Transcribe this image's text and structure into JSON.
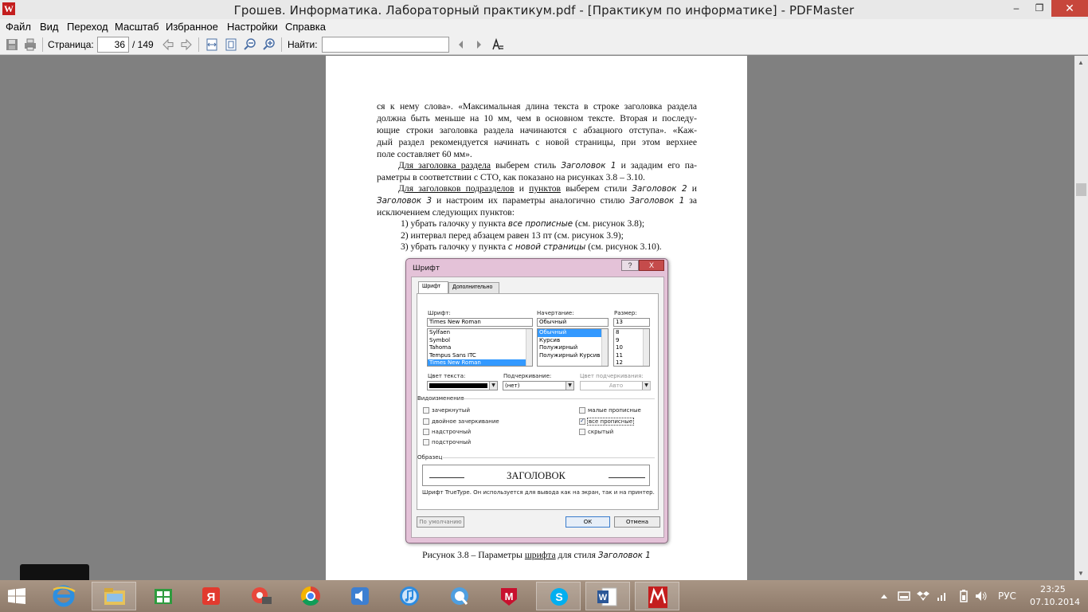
{
  "window": {
    "title": "Грошев. Информатика. Лабораторный практикум.pdf - [Практикум по информатике] - PDFMaster",
    "logo_letter": "W",
    "min_glyph": "–",
    "max_glyph": "❐",
    "close_glyph": "✕"
  },
  "menu": {
    "items": [
      "Файл",
      "Вид",
      "Переход",
      "Масштаб",
      "Избранное",
      "Настройки",
      "Справка"
    ]
  },
  "toolbar": {
    "page_label": "Страница:",
    "page_current": "36",
    "page_total": "/ 149",
    "find_label": "Найти:",
    "find_value": ""
  },
  "pdf": {
    "p1": [
      "ся к нему слова». «Максимальная длина текста в строке заголовка раздела",
      "должна быть меньше на 10 мм, чем в основном тексте. Вторая и последу-",
      "ющие строки заголовка раздела начинаются с абзацного отступа». «Каж-",
      "дый раздел рекомендуется начинать с новой страницы, при этом верхнее"
    ],
    "p1_last": "поле составляет 60 мм».",
    "p2_a": "Для заголовка раздела",
    "p2_b": " выберем стиль ",
    "p2_c": "Заголовок 1",
    "p2_d": " и зададим его па-",
    "p2_line2": "раметры в соответствии с СТО, как показано на рисунках 3.8 – 3.10.",
    "p3_a": "Для заголовков подразделов",
    "p3_b": " и ",
    "p3_c": "пунктов",
    "p3_d": " выберем стили ",
    "p3_e": "Заголовок 2",
    "p3_f": " и",
    "p3_g": "Заголовок 3",
    "p3_h": " и настроим их параметры аналогично стилю ",
    "p3_i": "Заголовок 1",
    "p3_j": " за",
    "p3_last": "исключением следующих пунктов:",
    "list": [
      {
        "n": "1)  убрать галочку у пункта ",
        "em": "все прописные",
        "t": " (см. рисунок 3.8);"
      },
      {
        "n": "2)  интервал перед абзацем равен 13 пт (см. рисунок 3.9);",
        "em": "",
        "t": ""
      },
      {
        "n": "3)  убрать галочку у пункта ",
        "em": "с новой страницы",
        "t": " (см. рисунок 3.10)."
      }
    ],
    "caption_a": "Рисунок 3.8 – Параметры ",
    "caption_b": "шрифта",
    "caption_c": " для стиля ",
    "caption_d": "Заголовок 1"
  },
  "font_dialog": {
    "title": "Шрифт",
    "help": "?",
    "close": "X",
    "tabs": [
      "Шрифт",
      "Дополнительно"
    ],
    "font_label": "Шрифт:",
    "font_value": "Times New Roman",
    "font_list": [
      "Sylfaen",
      "Symbol",
      "Tahoma",
      "Tempus Sans ITC",
      "Times New Roman"
    ],
    "style_label": "Начертание:",
    "style_value": "Обычный",
    "style_list": [
      "Обычный",
      "Курсив",
      "Полужирный",
      "Полужирный Курсив"
    ],
    "size_label": "Размер:",
    "size_value": "13",
    "size_list": [
      "8",
      "9",
      "10",
      "11",
      "12"
    ],
    "color_label": "Цвет текста:",
    "underline_label": "Подчеркивание:",
    "underline_value": "(нет)",
    "underline_color_label": "Цвет подчеркивания:",
    "underline_color_value": "Авто",
    "effects_label": "Видоизменение",
    "effects_left": [
      {
        "label": "зачеркнутый",
        "checked": false
      },
      {
        "label": "двойное зачеркивание",
        "checked": false
      },
      {
        "label": "надстрочный",
        "checked": false
      },
      {
        "label": "подстрочный",
        "checked": false
      }
    ],
    "effects_right": [
      {
        "label": "малые прописные",
        "checked": false
      },
      {
        "label": "все прописные",
        "checked": true
      },
      {
        "label": "скрытый",
        "checked": false
      }
    ],
    "sample_label": "Образец",
    "sample_text": "ЗАГОЛОВОК",
    "sample_note": "Шрифт TrueType. Он используется для вывода как на экран, так и на принтер.",
    "default_btn": "По умолчанию",
    "ok_btn": "ОК",
    "cancel_btn": "Отмена"
  },
  "taskbar": {
    "apps": [
      "internet-explorer",
      "file-explorer",
      "windows-store",
      "yandex-browser",
      "picasa",
      "chrome",
      "audio-player",
      "itunes",
      "quicktime",
      "mcafee",
      "skype",
      "word",
      "pdfmaster"
    ],
    "lang": "РУС",
    "time": "23:25",
    "date": "07.10.2014"
  }
}
